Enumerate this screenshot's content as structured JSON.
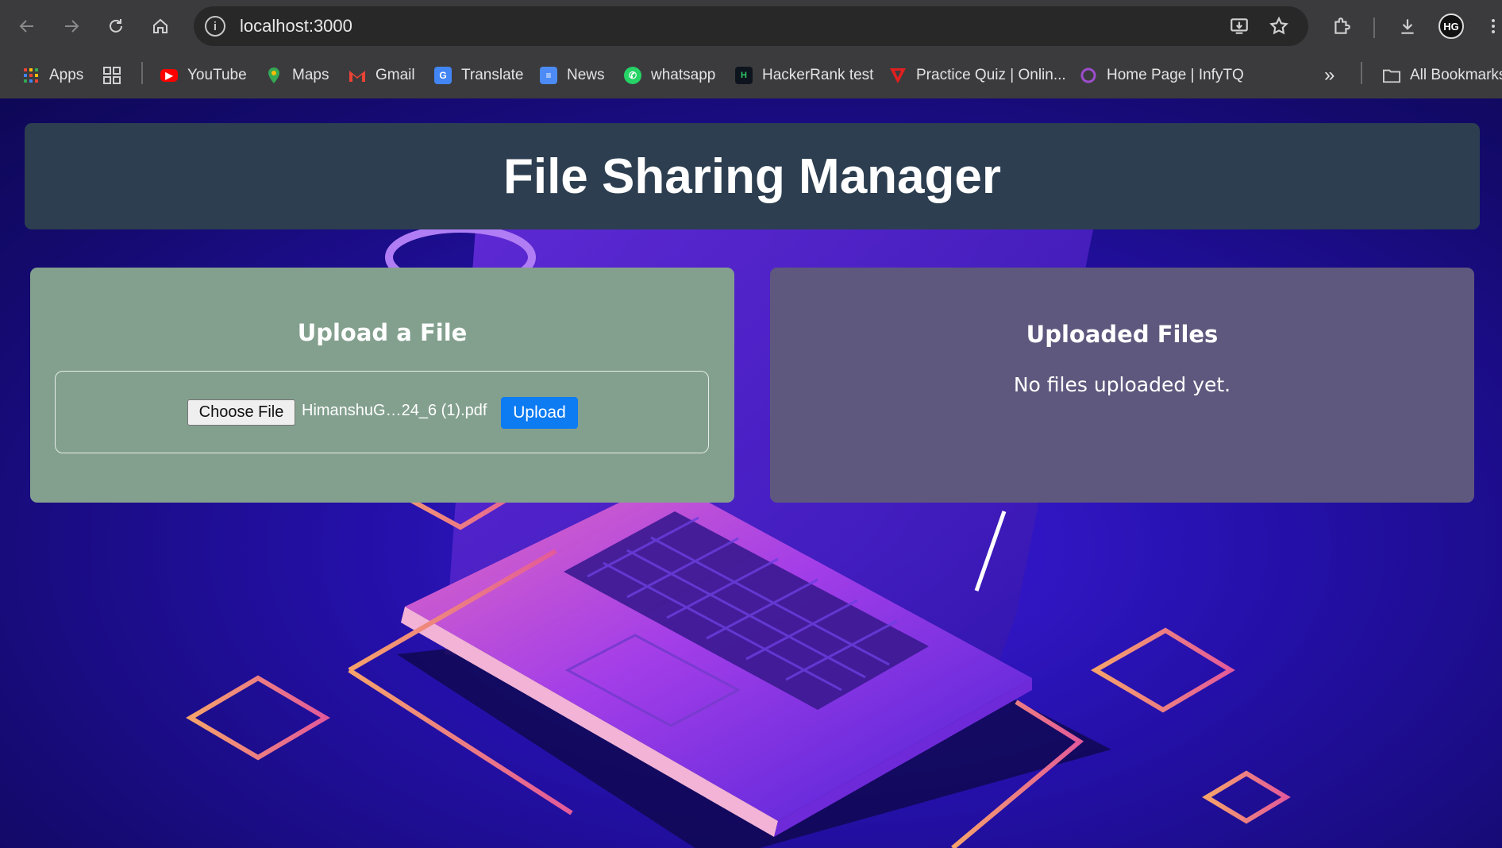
{
  "browser": {
    "url": "localhost:3000",
    "bookmarks": [
      {
        "label": "Apps",
        "icon": "apps-grid-icon"
      },
      {
        "label": "",
        "icon": "tab-groups-icon"
      },
      {
        "label": "YouTube",
        "icon": "youtube-icon"
      },
      {
        "label": "Maps",
        "icon": "maps-pin-icon"
      },
      {
        "label": "Gmail",
        "icon": "gmail-icon"
      },
      {
        "label": "Translate",
        "icon": "translate-icon"
      },
      {
        "label": "News",
        "icon": "news-icon"
      },
      {
        "label": "whatsapp",
        "icon": "whatsapp-icon"
      },
      {
        "label": "HackerRank test",
        "icon": "hackerrank-icon"
      },
      {
        "label": "Practice Quiz | Onlin...",
        "icon": "quiz-icon"
      },
      {
        "label": "Home Page | InfyTQ",
        "icon": "infytq-icon"
      }
    ],
    "overflow_label": "»",
    "all_bookmarks_label": "All Bookmarks",
    "profile_initials": "HG"
  },
  "page": {
    "title": "File Sharing Manager",
    "upload": {
      "heading": "Upload a File",
      "choose_label": "Choose File",
      "selected_file": "HimanshuG…24_6 (1).pdf",
      "upload_label": "Upload"
    },
    "files": {
      "heading": "Uploaded Files",
      "empty_message": "No files uploaded yet."
    }
  },
  "colors": {
    "header_bg": "#2c3e50",
    "upload_card_bg": "#83a08e",
    "files_card_bg": "#5f587e",
    "upload_button": "#0d7bf2",
    "page_bg": "#2410a8"
  }
}
